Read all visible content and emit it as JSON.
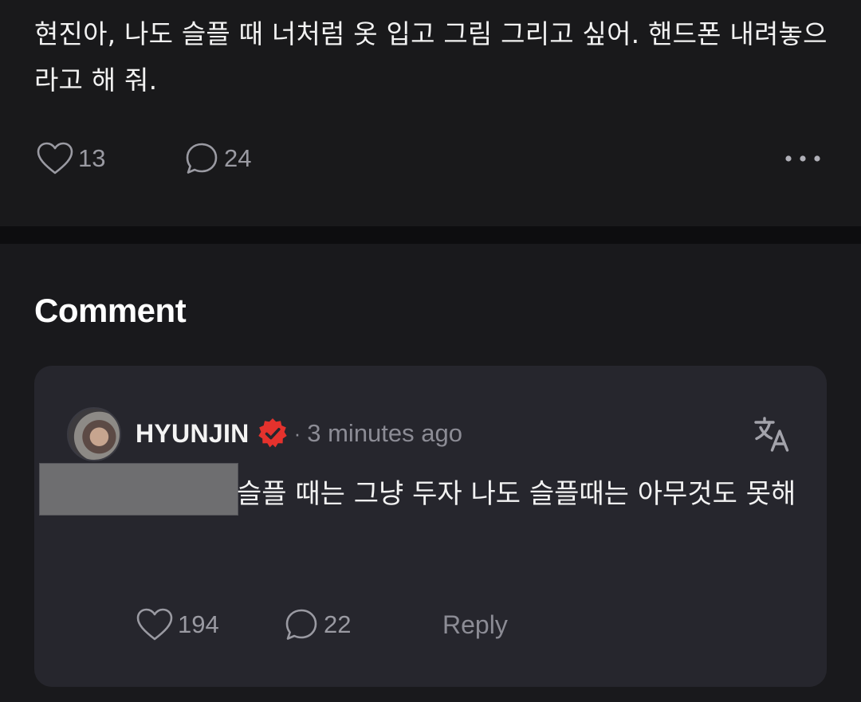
{
  "post": {
    "text": "현진아, 나도 슬플 때 너처럼 옷 입고 그림 그리고 싶어. 핸드폰 내려놓으라고 해 줘.",
    "likes": "13",
    "comments": "24"
  },
  "comment_section": {
    "title": "Comment",
    "comment": {
      "author": "HYUNJIN",
      "separator": "·",
      "timestamp": "3 minutes ago",
      "text": "슬플 때는 그냥 두자 나도 슬플때는 아무것도 못해",
      "likes": "194",
      "replies": "22",
      "reply_label": "Reply"
    }
  },
  "colors": {
    "background": "#19191b",
    "card": "#26262d",
    "muted_text": "#8c8c95",
    "verified_badge": "#e5322d"
  },
  "icons": [
    "heart-icon",
    "comment-bubble-icon",
    "more-options-icon",
    "verified-badge-icon",
    "translate-icon"
  ]
}
